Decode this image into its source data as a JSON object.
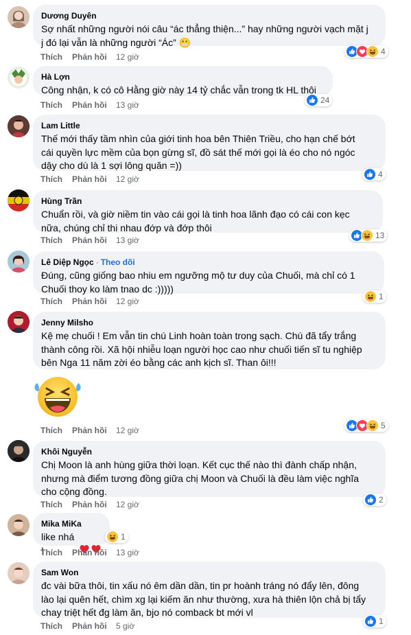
{
  "actions": {
    "like": "Thích",
    "reply": "Phản hồi"
  },
  "comments": [
    {
      "name": "Dương Duyên",
      "text": "Sợ nhất những người nói câu “ác thẳng thiện...” hay những người vạch mặt j\nj đó lại vẫn là những người “Ác” 😬",
      "time": "12 giờ",
      "count": "4",
      "reactions": [
        "like-icon",
        "love-icon",
        "haha-icon"
      ]
    },
    {
      "name": "Hà Lợn",
      "text": "Công nhận, k có cô Hằng giờ này 14 tỷ chắc vẫn trong tk HL thôi",
      "time": "13 giờ",
      "count": "24",
      "reactions": [
        "like-icon"
      ]
    },
    {
      "name": "Lam Little",
      "text": "Thế mới thấy tầm nhìn của giới tinh hoa bên Thiên Triều, cho hạn chế bớt\ncái quyền lực mềm của bọn gừng sĩ, đồ sát thế mới gọi là éo cho nó ngóc\ndậy cho dù là 1 sợi lông quăn =))",
      "time": "12 giờ",
      "count": "4",
      "reactions": [
        "like-icon"
      ]
    },
    {
      "name": "Hùng Trần",
      "text": "Chuẩn rồi, và giờ niềm tin vào cái gọi là tinh hoa lãnh đạo có cái con kẹc\nnữa, chúng chỉ thi nhau đớp và đớp thôi",
      "time": "13 giờ",
      "count": "13",
      "reactions": [
        "like-icon",
        "haha-icon"
      ]
    },
    {
      "name": "Lê Diệp Ngọc",
      "follow": "Theo dõi",
      "text": "Đúng, cũng giống bao nhiu em ngưỡng mộ tư duy của Chuối, mà chỉ có 1\nChuối thoy ko làm tnao dc :)))))",
      "time": "12 giờ",
      "count": "1",
      "reactions": [
        "haha-icon"
      ]
    },
    {
      "name": "Jenny Milsho",
      "text": "Kệ mẹ chuối ! Em vẫn tin chú Linh hoàn toàn trong sạch. Chú đã tẩy trắng\nthành công rồi. Xã hội nhiễu loạn người học cao như chuối tiến sĩ tu nghiệp\nbên Nga 11 năm zời éo bằng các anh kịch sĩ. Than ôi!!!",
      "time": "12 giờ",
      "count": "5",
      "reactions": [
        "like-icon",
        "love-icon",
        "haha-icon"
      ]
    },
    {
      "name": "Khôi Nguyễn",
      "text": "Chị Moon là anh hùng giữa thời loạn. Kết cục thế nào thì đành chấp nhận,\nnhưng mà điểm tương đồng giữa chị Moon và Chuối là đều làm việc nghĩa\ncho cộng đồng.",
      "time": "12 giờ",
      "count": "2",
      "reactions": [
        "like-icon"
      ]
    },
    {
      "name": "Mika MiKa",
      "text": "like nhá !",
      "time": "13 giờ",
      "count": "1",
      "reactions": [
        "haha-icon"
      ]
    },
    {
      "name": "Sam Won",
      "text": "đc vài bữa thôi, tin xấu nó êm dần dần, tin pr hoành tráng nó đẩy lên, đông\nlào lại quên hết, chìm xg lại kiếm ăn như thường, xưa hà thiên lộn chả bị tẩy\nchay triệt hết đg làm ăn, bjo nó comback bt mới vl",
      "time": "5 giờ",
      "count": "1",
      "reactions": [
        "like-icon"
      ]
    }
  ]
}
